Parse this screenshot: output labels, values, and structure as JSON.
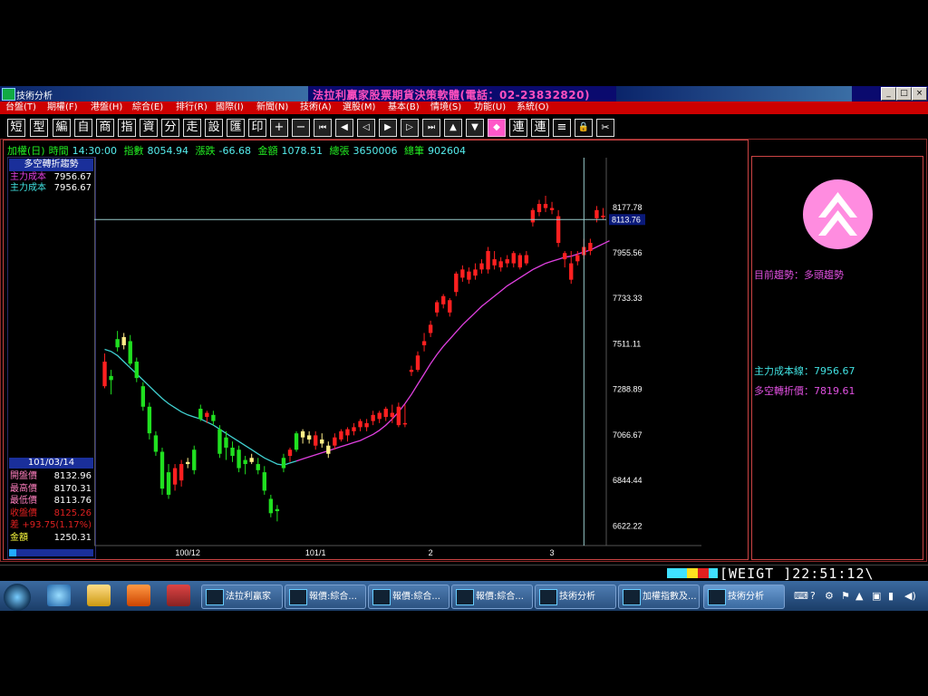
{
  "window": {
    "title": "技術分析",
    "banner": "法拉利贏家股票期貨決策軟體(電話：02-23832820)",
    "controls": [
      "_",
      "□",
      "×"
    ]
  },
  "menu": [
    {
      "label": "台盤(T)"
    },
    {
      "label": "期權(F)"
    },
    {
      "label": "港盤(H)"
    },
    {
      "label": "綜合(E)"
    },
    {
      "label": "排行(R)"
    },
    {
      "label": "國際(I)"
    },
    {
      "label": "新聞(N)"
    },
    {
      "label": "技術(A)"
    },
    {
      "label": "選股(M)"
    },
    {
      "label": "基本(B)"
    },
    {
      "label": "情境(S)"
    },
    {
      "label": "功能(U)"
    },
    {
      "label": "系統(O)"
    }
  ],
  "toolbar": {
    "text_buttons": [
      "短",
      "型",
      "編",
      "自",
      "商",
      "指",
      "資",
      "分",
      "走",
      "設",
      "匯",
      "印"
    ],
    "icon_buttons": [
      {
        "icon": "plus-icon",
        "glyph": "+"
      },
      {
        "icon": "minus-icon",
        "glyph": "−"
      },
      {
        "icon": "first-icon",
        "glyph": "⏮"
      },
      {
        "icon": "prev-icon",
        "glyph": "◀"
      },
      {
        "icon": "prev-page-icon",
        "glyph": "◁"
      },
      {
        "icon": "next-icon",
        "glyph": "▶"
      },
      {
        "icon": "next-page-icon",
        "glyph": "▷"
      },
      {
        "icon": "last-icon",
        "glyph": "⏭"
      },
      {
        "icon": "up-icon",
        "glyph": "▲"
      },
      {
        "icon": "down-icon",
        "glyph": "▼"
      },
      {
        "icon": "special-icon",
        "glyph": "◆"
      },
      {
        "icon": "link-icon",
        "glyph": "連"
      },
      {
        "icon": "link2-icon",
        "glyph": "連"
      },
      {
        "icon": "note-icon",
        "glyph": "≡"
      },
      {
        "icon": "lock-icon",
        "glyph": "🔒"
      },
      {
        "icon": "tools-icon",
        "glyph": "✂"
      }
    ]
  },
  "stats": {
    "index_name": "加權(日)",
    "time_label": "時間",
    "time": "14:30:00",
    "idx_label": "指數",
    "idx": "8054.94",
    "chg_label": "漲跌",
    "chg": "-66.68",
    "amt_label": "金額",
    "amt": "1078.51",
    "vol_label": "總張",
    "vol": "3650006",
    "cnt_label": "總筆",
    "cnt": "902604"
  },
  "left_panel": {
    "header": "多空轉折趨勢",
    "lines": [
      {
        "label": "主力成本",
        "value": "7956.67",
        "color": "#e040e0"
      },
      {
        "label": "主力成本",
        "value": "7956.67",
        "color": "#40e0e0"
      }
    ],
    "date": "101/03/14",
    "quotes": [
      {
        "label": "開盤價",
        "value": "8132.96",
        "color": "#ff7fbf"
      },
      {
        "label": "最高價",
        "value": "8170.31",
        "color": "#ff7fbf"
      },
      {
        "label": "最低價",
        "value": "8113.76",
        "color": "#ff7fbf"
      },
      {
        "label": "收盤價",
        "value": "8125.26",
        "color": "#e02020"
      },
      {
        "label": "差",
        "value": "+93.75(1.17%)",
        "color": "#e02020"
      },
      {
        "label": "金額",
        "value": "1250.31",
        "color": "#ffff40"
      }
    ]
  },
  "chart_data": {
    "type": "candlestick",
    "y_ticks": [
      "8177.78",
      "7955.56",
      "7733.33",
      "7511.11",
      "7288.89",
      "7066.67",
      "6844.44",
      "6622.22"
    ],
    "y_tick_values": [
      8177.78,
      7955.56,
      7733.33,
      7511.11,
      7288.89,
      7066.67,
      6844.44,
      6622.22
    ],
    "ylim": [
      6522,
      8407
    ],
    "x_ticks": [
      {
        "label": "100/12",
        "index": 13
      },
      {
        "label": "101/1",
        "index": 33
      },
      {
        "label": "2",
        "index": 51
      },
      {
        "label": "3",
        "index": 70
      }
    ],
    "crosshair": {
      "value": "8113.76",
      "y": 8113.76,
      "index": 75
    },
    "candles": [
      {
        "o": 7420,
        "h": 7460,
        "l": 7290,
        "c": 7300,
        "col": "red"
      },
      {
        "o": 7350,
        "h": 7380,
        "l": 7260,
        "c": 7330,
        "col": "green"
      },
      {
        "o": 7530,
        "h": 7570,
        "l": 7470,
        "c": 7490,
        "col": "green"
      },
      {
        "o": 7500,
        "h": 7560,
        "l": 7480,
        "c": 7540,
        "col": "yellow"
      },
      {
        "o": 7520,
        "h": 7550,
        "l": 7400,
        "c": 7410,
        "col": "green"
      },
      {
        "o": 7420,
        "h": 7440,
        "l": 7320,
        "c": 7340,
        "col": "green"
      },
      {
        "o": 7300,
        "h": 7320,
        "l": 7180,
        "c": 7200,
        "col": "green"
      },
      {
        "o": 7200,
        "h": 7220,
        "l": 7040,
        "c": 7070,
        "col": "green"
      },
      {
        "o": 7060,
        "h": 7080,
        "l": 6960,
        "c": 6980,
        "col": "green"
      },
      {
        "o": 6980,
        "h": 7000,
        "l": 6770,
        "c": 6800,
        "col": "green"
      },
      {
        "o": 6880,
        "h": 6920,
        "l": 6750,
        "c": 6770,
        "col": "green"
      },
      {
        "o": 6820,
        "h": 6920,
        "l": 6790,
        "c": 6900,
        "col": "red"
      },
      {
        "o": 6840,
        "h": 6940,
        "l": 6810,
        "c": 6920,
        "col": "red"
      },
      {
        "o": 6920,
        "h": 6950,
        "l": 6900,
        "c": 6930,
        "col": "yellow"
      },
      {
        "o": 6990,
        "h": 7010,
        "l": 6870,
        "c": 6890,
        "col": "green"
      },
      {
        "o": 7190,
        "h": 7210,
        "l": 7130,
        "c": 7140,
        "col": "green"
      },
      {
        "o": 7150,
        "h": 7180,
        "l": 7120,
        "c": 7170,
        "col": "red"
      },
      {
        "o": 7160,
        "h": 7180,
        "l": 7110,
        "c": 7130,
        "col": "green"
      },
      {
        "o": 7090,
        "h": 7110,
        "l": 6950,
        "c": 6970,
        "col": "green"
      },
      {
        "o": 7050,
        "h": 7080,
        "l": 6940,
        "c": 7000,
        "col": "green"
      },
      {
        "o": 7000,
        "h": 7030,
        "l": 6930,
        "c": 6960,
        "col": "green"
      },
      {
        "o": 6990,
        "h": 7010,
        "l": 6880,
        "c": 6900,
        "col": "green"
      },
      {
        "o": 6920,
        "h": 6960,
        "l": 6870,
        "c": 6940,
        "col": "green"
      },
      {
        "o": 6950,
        "h": 6970,
        "l": 6920,
        "c": 6930,
        "col": "yellow"
      },
      {
        "o": 6920,
        "h": 6950,
        "l": 6870,
        "c": 6890,
        "col": "green"
      },
      {
        "o": 6880,
        "h": 6910,
        "l": 6770,
        "c": 6790,
        "col": "green"
      },
      {
        "o": 6750,
        "h": 6770,
        "l": 6660,
        "c": 6680,
        "col": "green"
      },
      {
        "o": 6700,
        "h": 6720,
        "l": 6640,
        "c": 6690,
        "col": "green"
      },
      {
        "o": 6950,
        "h": 6970,
        "l": 6880,
        "c": 6900,
        "col": "green"
      },
      {
        "o": 6960,
        "h": 7000,
        "l": 6930,
        "c": 6990,
        "col": "red"
      },
      {
        "o": 6990,
        "h": 7080,
        "l": 6980,
        "c": 7070,
        "col": "green"
      },
      {
        "o": 7050,
        "h": 7090,
        "l": 7020,
        "c": 7080,
        "col": "yellow"
      },
      {
        "o": 7060,
        "h": 7080,
        "l": 7020,
        "c": 7040,
        "col": "yellow"
      },
      {
        "o": 7010,
        "h": 7080,
        "l": 6990,
        "c": 7060,
        "col": "red"
      },
      {
        "o": 7040,
        "h": 7070,
        "l": 7000,
        "c": 7020,
        "col": "yellow"
      },
      {
        "o": 6970,
        "h": 7030,
        "l": 6950,
        "c": 7010,
        "col": "yellow"
      },
      {
        "o": 7010,
        "h": 7070,
        "l": 6990,
        "c": 7050,
        "col": "red"
      },
      {
        "o": 7040,
        "h": 7090,
        "l": 7030,
        "c": 7080,
        "col": "red"
      },
      {
        "o": 7060,
        "h": 7100,
        "l": 7030,
        "c": 7090,
        "col": "red"
      },
      {
        "o": 7080,
        "h": 7120,
        "l": 7060,
        "c": 7100,
        "col": "red"
      },
      {
        "o": 7100,
        "h": 7140,
        "l": 7080,
        "c": 7130,
        "col": "red"
      },
      {
        "o": 7100,
        "h": 7140,
        "l": 7080,
        "c": 7120,
        "col": "red"
      },
      {
        "o": 7130,
        "h": 7180,
        "l": 7110,
        "c": 7160,
        "col": "red"
      },
      {
        "o": 7140,
        "h": 7180,
        "l": 7120,
        "c": 7170,
        "col": "red"
      },
      {
        "o": 7150,
        "h": 7200,
        "l": 7130,
        "c": 7190,
        "col": "red"
      },
      {
        "o": 7150,
        "h": 7210,
        "l": 7120,
        "c": 7170,
        "col": "red"
      },
      {
        "o": 7110,
        "h": 7220,
        "l": 7100,
        "c": 7200,
        "col": "red"
      },
      {
        "o": 7120,
        "h": 7210,
        "l": 7100,
        "c": 7120,
        "col": "red"
      },
      {
        "o": 7370,
        "h": 7400,
        "l": 7350,
        "c": 7380,
        "col": "red"
      },
      {
        "o": 7380,
        "h": 7470,
        "l": 7370,
        "c": 7450,
        "col": "red"
      },
      {
        "o": 7500,
        "h": 7560,
        "l": 7470,
        "c": 7520,
        "col": "red"
      },
      {
        "o": 7560,
        "h": 7620,
        "l": 7540,
        "c": 7600,
        "col": "red"
      },
      {
        "o": 7660,
        "h": 7720,
        "l": 7640,
        "c": 7710,
        "col": "red"
      },
      {
        "o": 7700,
        "h": 7750,
        "l": 7680,
        "c": 7740,
        "col": "red"
      },
      {
        "o": 7660,
        "h": 7730,
        "l": 7640,
        "c": 7720,
        "col": "red"
      },
      {
        "o": 7760,
        "h": 7860,
        "l": 7740,
        "c": 7850,
        "col": "red"
      },
      {
        "o": 7830,
        "h": 7890,
        "l": 7810,
        "c": 7870,
        "col": "red"
      },
      {
        "o": 7820,
        "h": 7880,
        "l": 7800,
        "c": 7860,
        "col": "red"
      },
      {
        "o": 7840,
        "h": 7900,
        "l": 7820,
        "c": 7870,
        "col": "red"
      },
      {
        "o": 7870,
        "h": 7920,
        "l": 7850,
        "c": 7900,
        "col": "red"
      },
      {
        "o": 7870,
        "h": 7980,
        "l": 7850,
        "c": 7960,
        "col": "red"
      },
      {
        "o": 7920,
        "h": 7960,
        "l": 7870,
        "c": 7890,
        "col": "red"
      },
      {
        "o": 7880,
        "h": 7930,
        "l": 7860,
        "c": 7910,
        "col": "red"
      },
      {
        "o": 7900,
        "h": 7940,
        "l": 7880,
        "c": 7920,
        "col": "red"
      },
      {
        "o": 7900,
        "h": 7960,
        "l": 7880,
        "c": 7950,
        "col": "red"
      },
      {
        "o": 7880,
        "h": 7950,
        "l": 7870,
        "c": 7940,
        "col": "red"
      },
      {
        "o": 7900,
        "h": 7960,
        "l": 7890,
        "c": 7940,
        "col": "red"
      },
      {
        "o": 8100,
        "h": 8170,
        "l": 8080,
        "c": 8160,
        "col": "red"
      },
      {
        "o": 8150,
        "h": 8210,
        "l": 8130,
        "c": 8190,
        "col": "red"
      },
      {
        "o": 8170,
        "h": 8230,
        "l": 8150,
        "c": 8190,
        "col": "red"
      },
      {
        "o": 8160,
        "h": 8200,
        "l": 8140,
        "c": 8170,
        "col": "red"
      },
      {
        "o": 8130,
        "h": 8160,
        "l": 7980,
        "c": 8000,
        "col": "red"
      },
      {
        "o": 7920,
        "h": 7960,
        "l": 7880,
        "c": 7950,
        "col": "red"
      },
      {
        "o": 7900,
        "h": 7960,
        "l": 7800,
        "c": 7820,
        "col": "red"
      },
      {
        "o": 7910,
        "h": 7960,
        "l": 7890,
        "c": 7940,
        "col": "red"
      },
      {
        "o": 7980,
        "h": 8020,
        "l": 7920,
        "c": 7940,
        "col": "red"
      },
      {
        "o": 7960,
        "h": 8020,
        "l": 7940,
        "c": 8000,
        "col": "red"
      },
      {
        "o": 8120,
        "h": 8180,
        "l": 8100,
        "c": 8160,
        "col": "red"
      },
      {
        "o": 8133,
        "h": 8170,
        "l": 8114,
        "c": 8125,
        "col": "red"
      }
    ],
    "ma_series": [
      {
        "name": "主力成本",
        "color": "#40d0d0",
        "from": 0,
        "to": 30,
        "values": [
          7480,
          7470,
          7450,
          7420,
          7390,
          7360,
          7330,
          7300,
          7270,
          7240,
          7215,
          7195,
          7175,
          7160,
          7150,
          7140,
          7125,
          7110,
          7090,
          7070,
          7050,
          7030,
          7010,
          6990,
          6970,
          6950,
          6935,
          6920,
          6915,
          6925,
          6935
        ]
      },
      {
        "name": "主力成本",
        "color": "#e040e0",
        "from": 30,
        "to": 79,
        "values": [
          6935,
          6945,
          6955,
          6965,
          6975,
          6985,
          6995,
          7005,
          7015,
          7025,
          7035,
          7050,
          7065,
          7085,
          7110,
          7140,
          7175,
          7215,
          7260,
          7310,
          7360,
          7410,
          7455,
          7495,
          7530,
          7565,
          7600,
          7630,
          7660,
          7690,
          7715,
          7740,
          7765,
          7790,
          7810,
          7830,
          7850,
          7870,
          7885,
          7900,
          7910,
          7920,
          7930,
          7935,
          7945,
          7955,
          7965,
          7980,
          7995,
          8010
        ]
      }
    ]
  },
  "right_panel": {
    "trend_label": "目前趨勢：多頭趨勢",
    "cost_label": "主力成本線：7956.67",
    "pivot_label": "多空轉折價：7819.61"
  },
  "status": {
    "clock": "[WEIGT_]22:51:12\\"
  },
  "taskbar": {
    "tasks": [
      {
        "label": "法拉利贏家"
      },
      {
        "label": "報價:綜合..."
      },
      {
        "label": "報價:綜合..."
      },
      {
        "label": "報價:綜合..."
      },
      {
        "label": "技術分析"
      },
      {
        "label": "加權指數及..."
      },
      {
        "label": "技術分析"
      }
    ]
  }
}
